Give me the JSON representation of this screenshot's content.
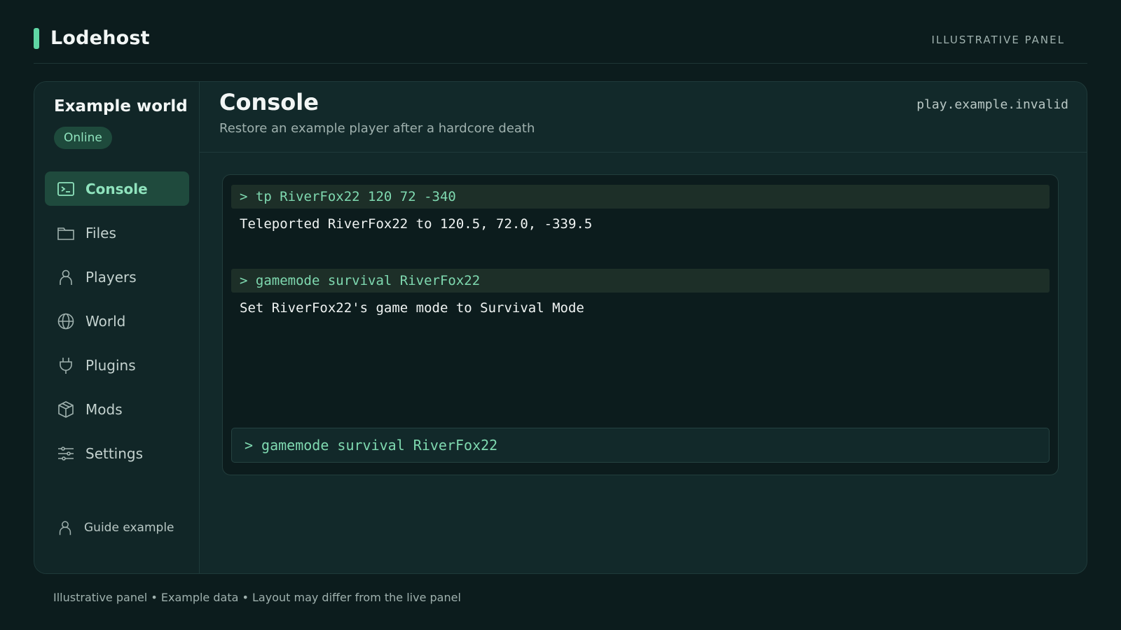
{
  "header": {
    "brand": "Lodehost",
    "tag": "ILLUSTRATIVE PANEL"
  },
  "sidebar": {
    "server_name": "Example world",
    "status": "Online",
    "items": [
      {
        "label": "Console",
        "icon": "terminal-icon",
        "active": true
      },
      {
        "label": "Files",
        "icon": "folder-icon",
        "active": false
      },
      {
        "label": "Players",
        "icon": "user-icon",
        "active": false
      },
      {
        "label": "World",
        "icon": "globe-icon",
        "active": false
      },
      {
        "label": "Plugins",
        "icon": "plug-icon",
        "active": false
      },
      {
        "label": "Mods",
        "icon": "cube-icon",
        "active": false
      },
      {
        "label": "Settings",
        "icon": "sliders-icon",
        "active": false
      }
    ],
    "user": {
      "label": "Guide example",
      "icon": "user-icon"
    }
  },
  "main": {
    "title": "Console",
    "subtitle": "Restore an example player after a hardcore death",
    "address": "play.example.invalid",
    "log": [
      {
        "command": "> tp RiverFox22 120 72 -340",
        "output": "Teleported RiverFox22 to 120.5, 72.0, -339.5"
      },
      {
        "command": "> gamemode survival RiverFox22",
        "output": "Set RiverFox22's game mode to Survival Mode"
      }
    ],
    "input": {
      "prompt": ">",
      "value": "gamemode survival RiverFox22"
    }
  },
  "footer": "Illustrative panel • Example data • Layout may differ from the live panel",
  "colors": {
    "background": "#0c1c1d",
    "panel": "#12292a",
    "accent": "#5fd6a4",
    "accent_text": "#8fe3bd",
    "command_text": "#7fd9b0"
  }
}
